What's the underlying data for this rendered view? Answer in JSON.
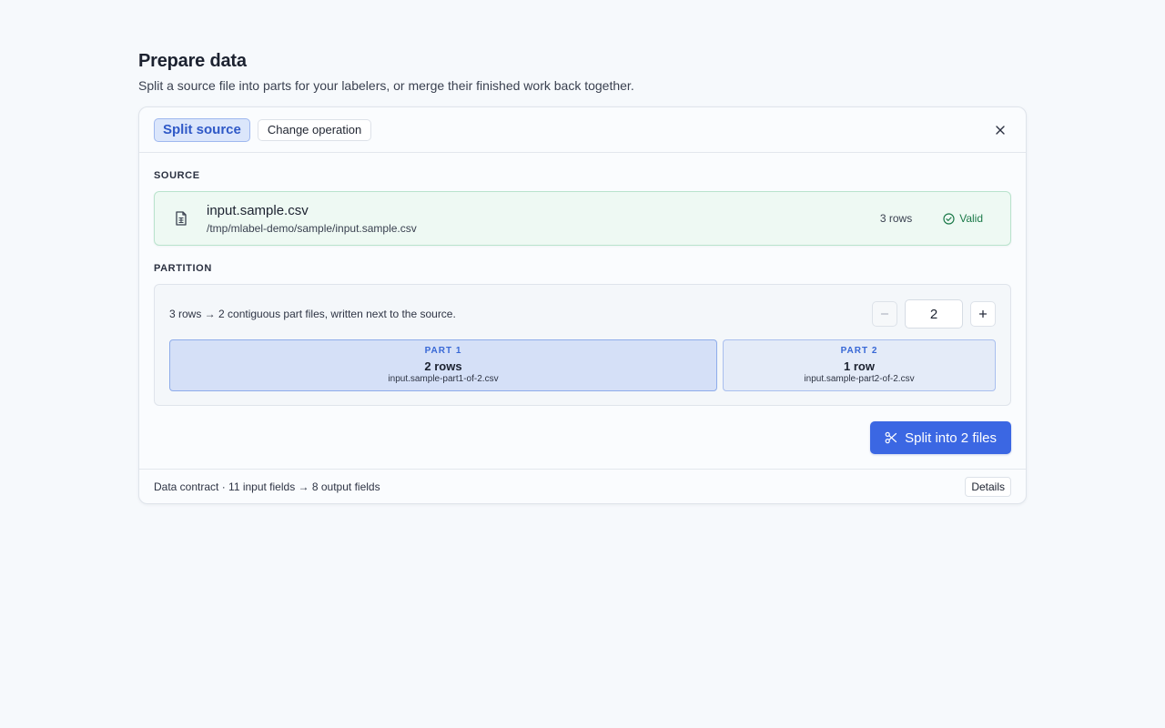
{
  "page": {
    "title": "Prepare data",
    "subtitle": "Split a source file into parts for your labelers, or merge their finished work back together."
  },
  "header": {
    "active_operation": "Split source",
    "change_operation_label": "Change operation",
    "close_icon": "close-icon"
  },
  "source": {
    "section_label": "SOURCE",
    "file_name": "input.sample.csv",
    "file_path": "/tmp/mlabel-demo/sample/input.sample.csv",
    "row_count": "3 rows",
    "status": "Valid",
    "file_icon": "file-spreadsheet-icon",
    "status_icon": "check-circle-icon"
  },
  "partition": {
    "section_label": "PARTITION",
    "description": "3 rows → 2 contiguous part files, written next to the source.",
    "part_count": "2",
    "decrement_icon": "minus-icon",
    "increment_icon": "plus-icon",
    "parts": [
      {
        "tag": "PART 1",
        "rows": "2 rows",
        "file": "input.sample-part1-of-2.csv",
        "row_value": 2
      },
      {
        "tag": "PART 2",
        "rows": "1 row",
        "file": "input.sample-part2-of-2.csv",
        "row_value": 1
      }
    ]
  },
  "actions": {
    "split_label": "Split into 2 files",
    "split_icon": "scissors-icon"
  },
  "footer": {
    "contract_text": "Data contract · 11 input fields → 8 output fields",
    "details_label": "Details"
  },
  "colors": {
    "accent": "#3b67e3",
    "valid": "#1d7a4a",
    "part_highlight": "#d5e0f7"
  }
}
